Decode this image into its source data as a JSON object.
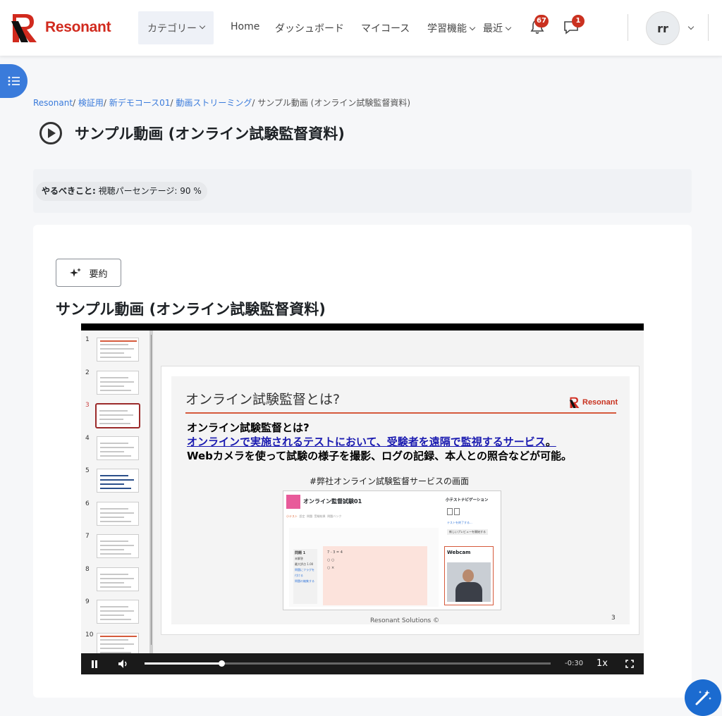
{
  "navbar": {
    "brand": "Resonant",
    "category_label": "カテゴリー",
    "links": [
      "Home",
      "ダッシュボード",
      "マイコース"
    ],
    "learning_label": "学習機能",
    "recent_label": "最近",
    "notifications_count": "67",
    "messages_count": "1",
    "user_initials": "rr"
  },
  "breadcrumb": {
    "items": [
      "Resonant",
      "検証用",
      "新デモコース01",
      "動画ストリーミング"
    ],
    "current": "サンプル動画 (オンライン試験監督資料)"
  },
  "page": {
    "title": "サンプル動画 (オンライン試験監督資料)"
  },
  "completion": {
    "label": "やるべきこと:",
    "value": "視聴パーセンテージ: 90 %"
  },
  "card": {
    "summary_button": "要約",
    "video_title": "サンプル動画 (オンライン試験監督資料)"
  },
  "player": {
    "thumb_numbers": [
      "1",
      "2",
      "3",
      "4",
      "5",
      "6",
      "7",
      "8",
      "9",
      "10"
    ],
    "current_slide_index": 2,
    "progress_fraction": 0.19,
    "time_remaining": "-0:30",
    "speed": "1x",
    "slide": {
      "heading": "オンライン試験監督とは?",
      "logo": "Resonant",
      "line1": "オンライン試験監督とは?",
      "line2": "オンラインで実施されるテストにおいて、受験者を遠隔で監視するサービス",
      "line2_end": "。",
      "line3": "Webカメラを使って試験の様子を撮影、ログの記録、本人との照合などが可能。",
      "caption": "#弊社オンライン試験監督サービスの画面",
      "footer": "Resonant Solutions ©",
      "page_number": "3",
      "shot": {
        "quiz_title": "オンライン監督試験01",
        "tabs": [
          "小テスト",
          "設定",
          "問題",
          "受験結果",
          "問題バンク"
        ],
        "question_label": "問題 1",
        "question_status": "未解答",
        "question_points": "最大評点 1.00",
        "question_flag": "問題にフラグを付ける",
        "question_edit": "問題の編集する",
        "question_text": "7 - 3 = 4",
        "option_a": "○",
        "option_b": "×",
        "nav_title": "小テストナビゲーション",
        "finish_link": "テストを終了する...",
        "preview_btn": "新しいプレビューを開始する",
        "webcam_label": "Webcam"
      }
    }
  },
  "colors": {
    "accent": "#3a7bdb",
    "brand_red": "#d12a1e",
    "badge": "#ca3120"
  }
}
